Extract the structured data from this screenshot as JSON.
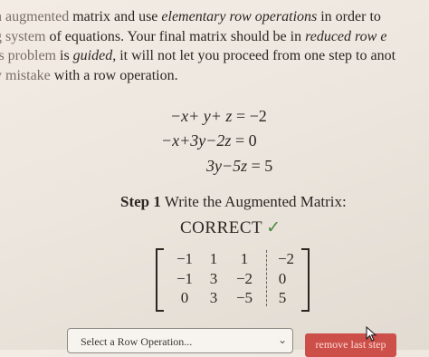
{
  "intro": {
    "line1": {
      "faded": "n augmented",
      "rest_a": " matrix and use ",
      "emph": "elementary row operations",
      "rest_b": " in order to"
    },
    "line2": {
      "faded": "g system",
      "rest_a": " of equations. Your final matrix should be in ",
      "emph": "reduced row e",
      "rest_b": ""
    },
    "line3": {
      "faded": "is problem",
      "rest_a": " is ",
      "emph": "guided",
      "rest_b": ", it will not let you proceed from one step to anot"
    },
    "line4": {
      "faded": "y mistake",
      "rest_a": " with a row operation.",
      "emph": "",
      "rest_b": ""
    }
  },
  "equations": [
    {
      "lhs": "−x+ y+ z",
      "eq": " = ",
      "rhs": "−2"
    },
    {
      "lhs": "−x+3y−2z",
      "eq": " = ",
      "rhs": "0"
    },
    {
      "lhs": "3y−5z",
      "eq": " = ",
      "rhs": "5"
    }
  ],
  "step": {
    "label": "Step 1",
    "title": "Write the Augmented Matrix:"
  },
  "status": {
    "text": "CORRECT",
    "check": "✓"
  },
  "matrix": [
    [
      "−1",
      "1",
      "1",
      "−2"
    ],
    [
      "−1",
      "3",
      "−2",
      "0"
    ],
    [
      "0",
      "3",
      "−5",
      "5"
    ]
  ],
  "controls": {
    "select_placeholder": "Select a Row Operation...",
    "remove_button": "remove last step"
  },
  "colors": {
    "button": "#cc4f4a",
    "check": "#4a8a3a"
  },
  "icons": {
    "dropdown": "chevron-down-icon",
    "status": "checkmark-icon",
    "pointer": "cursor-icon"
  }
}
